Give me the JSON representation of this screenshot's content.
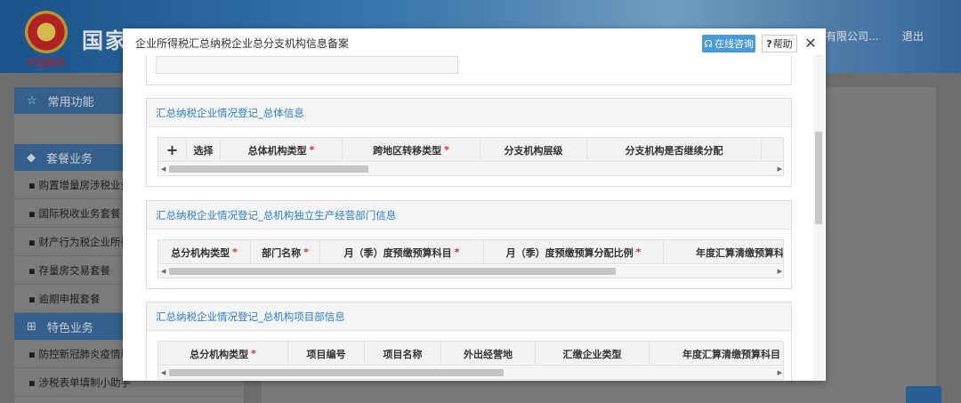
{
  "background": {
    "site_title": "国家税务总局电子税务局",
    "logo_text": "中国税务",
    "user_name": "有限公司...",
    "logout_label": "退出",
    "sidebar": {
      "common_label": "常用功能",
      "package_label": "套餐业务",
      "package_items": [
        "购置增量房涉税业务",
        "国际税收业务套餐",
        "财产行为税企业所得",
        "存量房交易套餐",
        "逾期申报套餐"
      ],
      "special_label": "特色业务",
      "special_items": [
        "防控新冠肺炎疫情税",
        "涉税表单填制小助手"
      ]
    }
  },
  "modal": {
    "title": "企业所得税汇总纳税企业总分支机构信息备案",
    "consult_label": "在线咨询",
    "help_label": "帮助",
    "close_glyph": "✕",
    "sections": [
      {
        "title": "汇总纳税企业情况登记_总体信息",
        "add_glyph": "+",
        "columns": [
          {
            "label": "选择",
            "required": false
          },
          {
            "label": "总体机构类型",
            "required": true
          },
          {
            "label": "跨地区转移类型",
            "required": true
          },
          {
            "label": "分支机构层级",
            "required": false
          },
          {
            "label": "分支机构是否继续分配",
            "required": false
          }
        ]
      },
      {
        "title": "汇总纳税企业情况登记_总机构独立生产经营部门信息",
        "columns": [
          {
            "label": "总分机构类型",
            "required": true
          },
          {
            "label": "部门名称",
            "required": true
          },
          {
            "label": "月（季）度预缴预算科目",
            "required": true
          },
          {
            "label": "月（季）度预缴预算分配比例",
            "required": true
          },
          {
            "label": "年度汇算清缴预算科",
            "required": false
          }
        ]
      },
      {
        "title": "汇总纳税企业情况登记_总机构项目部信息",
        "columns": [
          {
            "label": "总分机构类型",
            "required": true
          },
          {
            "label": "项目编号",
            "required": false
          },
          {
            "label": "项目名称",
            "required": false
          },
          {
            "label": "外出经营地",
            "required": false
          },
          {
            "label": "汇缴企业类型",
            "required": false
          },
          {
            "label": "年度汇算清缴预算科目",
            "required": false
          }
        ]
      }
    ],
    "required_mark": "*"
  }
}
